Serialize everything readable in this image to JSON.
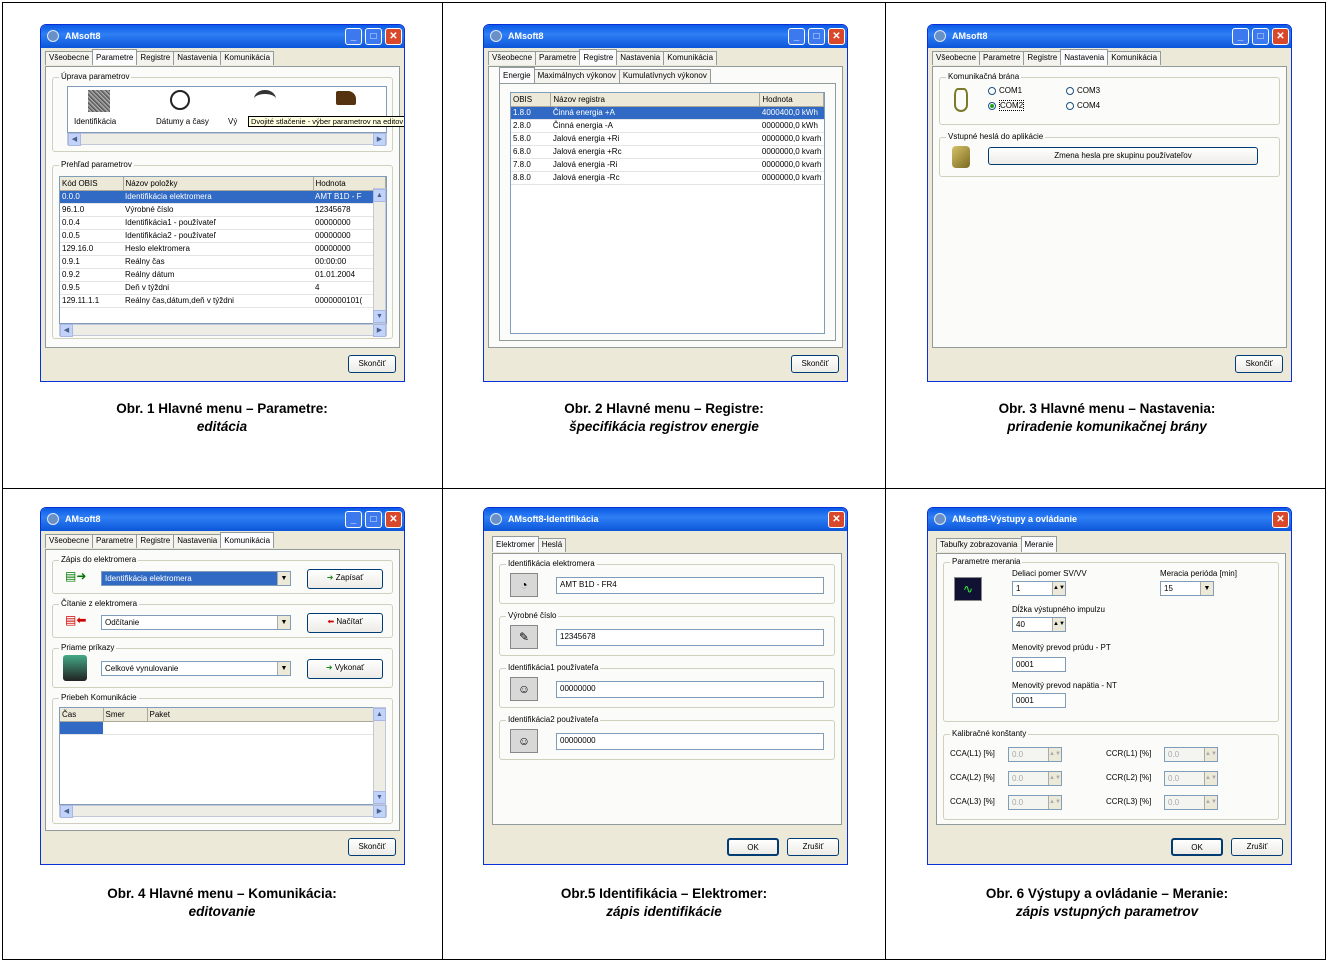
{
  "app_title": "AMsoft8",
  "main_tabs": [
    "Všeobecne",
    "Parametre",
    "Registre",
    "Nastavenia",
    "Komunikácia"
  ],
  "close_label": "Skončiť",
  "w1": {
    "group1": "Úprava parametrov",
    "icons": [
      "Identifikácia",
      "Dátumy a časy",
      "Vý"
    ],
    "tooltip": "Dvojité stlačenie - výber parametrov na editov",
    "group2": "Prehľad parametrov",
    "headers": [
      "Kód OBIS",
      "Názov položky",
      "Hodnota"
    ],
    "rows": [
      [
        "0.0.0",
        "Identifikácia elektromera",
        "AMT B1D - F"
      ],
      [
        "96.1.0",
        "Výrobné číslo",
        "12345678"
      ],
      [
        "0.0.4",
        "Identifikácia1 - používateľ",
        "00000000"
      ],
      [
        "0.0.5",
        "Identifikácia2 - používateľ",
        "00000000"
      ],
      [
        "129.16.0",
        "Heslo elektromera",
        "00000000"
      ],
      [
        "0.9.1",
        "Reálny čas",
        "00:00:00"
      ],
      [
        "0.9.2",
        "Reálny dátum",
        "01.01.2004"
      ],
      [
        "0.9.5",
        "Deň v týždni",
        "4"
      ],
      [
        "129.11.1.1",
        "Reálny čas,dátum,deň v týždni",
        "0000000101("
      ]
    ]
  },
  "w2": {
    "subtabs": [
      "Energie",
      "Maximálnych výkonov",
      "Kumulatívnych výkonov"
    ],
    "headers": [
      "OBIS",
      "Názov registra",
      "Hodnota"
    ],
    "rows": [
      [
        "1.8.0",
        "Činná energia +A",
        "4000400,0 kWh"
      ],
      [
        "2.8.0",
        "Činná energia -A",
        "0000000,0 kWh"
      ],
      [
        "5.8.0",
        "Jalová energia +Ri",
        "0000000,0 kvarh"
      ],
      [
        "6.8.0",
        "Jalová energia +Rc",
        "0000000,0 kvarh"
      ],
      [
        "7.8.0",
        "Jalová energia -Ri",
        "0000000,0 kvarh"
      ],
      [
        "8.8.0",
        "Jalová energia -Rc",
        "0000000,0 kvarh"
      ]
    ]
  },
  "w3": {
    "group1": "Komunikačná brána",
    "ports": [
      "COM1",
      "COM2",
      "COM3",
      "COM4"
    ],
    "group2": "Vstupné heslá do aplikácie",
    "pwd_button": "Zmena hesla pre skupinu používateľov"
  },
  "w4": {
    "g1": "Zápis do elektromera",
    "g1_value": "Identifikácia elektromera",
    "g1_button": "Zapísať",
    "g2": "Čítanie z elektromera",
    "g2_value": "Odčítanie",
    "g2_button": "Načítať",
    "g3": "Priame príkazy",
    "g3_value": "Celkové vynulovanie",
    "g3_button": "Vykonať",
    "g4": "Priebeh Komunikácie",
    "headers": [
      "Čas",
      "Smer",
      "Paket"
    ]
  },
  "w5": {
    "title": "AMsoft8-Identifikácia",
    "tabs": [
      "Elektromer",
      "Heslá"
    ],
    "fields": [
      {
        "label": "Identifikácia elektromera",
        "value": "AMT B1D - FR4"
      },
      {
        "label": "Výrobné číslo",
        "value": "12345678"
      },
      {
        "label": "Identifikácia1 používateľa",
        "value": "00000000"
      },
      {
        "label": "Identifikácia2 používateľa",
        "value": "00000000"
      }
    ],
    "ok": "OK",
    "cancel": "Zrušiť"
  },
  "w6": {
    "title": "AMsoft8-Výstupy a ovládanie",
    "tabs": [
      "Tabuľky zobrazovania",
      "Meranie"
    ],
    "group1": "Parametre merania",
    "delic_label": "Deliaci pomer SV/VV",
    "delic_value": "1",
    "period_label": "Meracia perióda [min]",
    "period_value": "15",
    "pulse_label": "Dĺžka výstupného impulzu",
    "pulse_value": "40",
    "pt_label": "Menovitý prevod prúdu - PT",
    "pt_value": "0001",
    "nt_label": "Menovitý prevod napätia - NT",
    "nt_value": "0001",
    "group2": "Kalibračné konštanty",
    "cal_labels": [
      "CCA(L1) [%]",
      "CCA(L2) [%]",
      "CCA(L3) [%]",
      "CCR(L1) [%]",
      "CCR(L2) [%]",
      "CCR(L3) [%]"
    ],
    "cal_value": "0.0",
    "ok": "OK",
    "cancel": "Zrušiť"
  },
  "captions": [
    {
      "t": "Obr. 1  Hlavné menu – Parametre:",
      "s": "editácia"
    },
    {
      "t": "Obr. 2  Hlavné menu – Registre:",
      "s": "špecifikácia registrov energie"
    },
    {
      "t": "Obr. 3  Hlavné menu – Nastavenia:",
      "s": "priradenie komunikačnej brány"
    },
    {
      "t": "Obr. 4  Hlavné menu – Komunikácia:",
      "s": "editovanie"
    },
    {
      "t": "Obr.5  Identifikácia – Elektromer:",
      "s": "zápis identifikácie"
    },
    {
      "t": "Obr. 6  Výstupy a ovládanie – Meranie:",
      "s": "zápis vstupných parametrov"
    }
  ]
}
